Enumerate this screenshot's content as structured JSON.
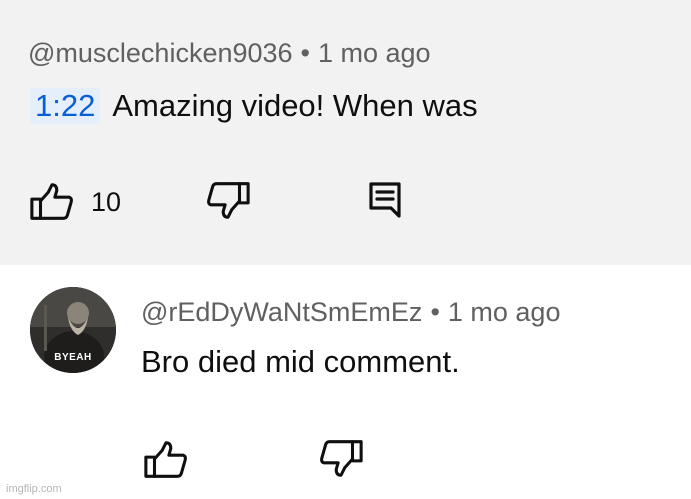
{
  "parent_comment": {
    "author": "@musclechicken9036",
    "separator": "•",
    "time_ago": "1 mo ago",
    "timestamp_link": "1:22",
    "text": "Amazing video! When was",
    "like_count": "10",
    "icons": [
      "thumbs-up-icon",
      "thumbs-down-icon",
      "reply-icon"
    ]
  },
  "reply": {
    "author": "@rEdDyWaNtSmEmEz",
    "separator": "•",
    "time_ago": "1 mo ago",
    "text": "Bro died mid comment.",
    "avatar_caption": "BYEAH",
    "icons": [
      "thumbs-up-icon",
      "thumbs-down-icon"
    ]
  },
  "watermark": "imgflip.com",
  "colors": {
    "timestamp_link": "#065fd4",
    "timestamp_bg": "#e5eefb",
    "meta_text": "#606060",
    "top_background": "#f2f2f2"
  }
}
